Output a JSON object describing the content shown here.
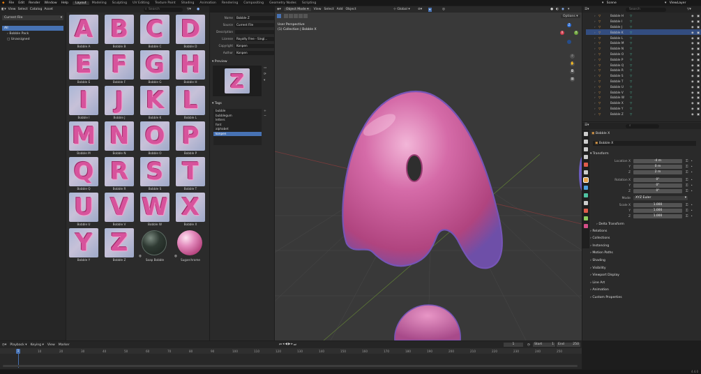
{
  "menubar": {
    "menus": [
      "File",
      "Edit",
      "Render",
      "Window",
      "Help"
    ],
    "workspaces": [
      "Layout",
      "Modeling",
      "Sculpting",
      "UV Editing",
      "Texture Paint",
      "Shading",
      "Animation",
      "Rendering",
      "Compositing",
      "Geometry Nodes",
      "Scripting"
    ],
    "active_workspace": "Layout",
    "scene": "Scene",
    "view_layer": "ViewLayer"
  },
  "asset_browser": {
    "header_menus": [
      "View",
      "Select",
      "Catalog",
      "Asset"
    ],
    "library": "Current File",
    "search_placeholder": "Search",
    "catalog_tree": [
      "All",
      "Bobble Pack",
      "Unassigned"
    ],
    "assets": [
      {
        "name": "Bobble A",
        "glyph": "A"
      },
      {
        "name": "Bobble B",
        "glyph": "B"
      },
      {
        "name": "Bobble C",
        "glyph": "C"
      },
      {
        "name": "Bobble D",
        "glyph": "D"
      },
      {
        "name": "Bobble E",
        "glyph": "E"
      },
      {
        "name": "Bobble F",
        "glyph": "F"
      },
      {
        "name": "Bobble G",
        "glyph": "G"
      },
      {
        "name": "Bobble H",
        "glyph": "H"
      },
      {
        "name": "Bobble I",
        "glyph": "I"
      },
      {
        "name": "Bobble J",
        "glyph": "J"
      },
      {
        "name": "Bobble K",
        "glyph": "K"
      },
      {
        "name": "Bobble L",
        "glyph": "L"
      },
      {
        "name": "Bobble M",
        "glyph": "M"
      },
      {
        "name": "Bobble N",
        "glyph": "N"
      },
      {
        "name": "Bobble O",
        "glyph": "O"
      },
      {
        "name": "Bobble P",
        "glyph": "P"
      },
      {
        "name": "Bobble Q",
        "glyph": "Q"
      },
      {
        "name": "Bobble R",
        "glyph": "R"
      },
      {
        "name": "Bobble S",
        "glyph": "S"
      },
      {
        "name": "Bobble T",
        "glyph": "T"
      },
      {
        "name": "Bobble U",
        "glyph": "U"
      },
      {
        "name": "Bobble V",
        "glyph": "V"
      },
      {
        "name": "Bobble W",
        "glyph": "W"
      },
      {
        "name": "Bobble X",
        "glyph": "X"
      },
      {
        "name": "Bobble Y",
        "glyph": "Y"
      },
      {
        "name": "Bobble Z",
        "glyph": "Z"
      },
      {
        "name": "Soap Bobble",
        "glyph": ""
      },
      {
        "name": "Sugarchrome",
        "glyph": ""
      }
    ]
  },
  "asset_details": {
    "fields": [
      {
        "label": "Name",
        "value": "Bobble Z"
      },
      {
        "label": "Source",
        "value": "Current File"
      },
      {
        "label": "Description",
        "value": ""
      },
      {
        "label": "License",
        "value": "Royalty Free - Singl..."
      },
      {
        "label": "Copyright",
        "value": "Konpen"
      },
      {
        "label": "Author",
        "value": "Konpen"
      }
    ],
    "preview_title": "Preview",
    "preview_glyph": "Z",
    "tags_title": "Tags",
    "tags": [
      "bubble",
      "bubblegum",
      "letters",
      "font",
      "alphabet",
      "konpen"
    ],
    "selected_tag": "konpen"
  },
  "viewport": {
    "header_menus": [
      "View",
      "Select",
      "Add",
      "Object"
    ],
    "mode": "Object Mode",
    "orientation": "Global",
    "options_label": "Options",
    "info_line1": "User Perspective",
    "info_line2": "(1) Collection | Bobble X",
    "axes": [
      "X",
      "Y",
      "Z"
    ]
  },
  "outliner": {
    "search_placeholder": "Search",
    "items": [
      "Bobble H",
      "Bobble I",
      "Bobble J",
      "Bobble K",
      "Bobble L",
      "Bobble M",
      "Bobble N",
      "Bobble O",
      "Bobble P",
      "Bobble Q",
      "Bobble R",
      "Bobble S",
      "Bobble T",
      "Bobble U",
      "Bobble V",
      "Bobble W",
      "Bobble X",
      "Bobble Y",
      "Bobble Z"
    ],
    "selected": "Bobble K"
  },
  "properties": {
    "object_name_header": "Bobble X",
    "object_name": "Bobble X",
    "transform_title": "Transform",
    "location": [
      {
        "label": "Location X",
        "value": "-4 m"
      },
      {
        "label": "Y",
        "value": "0 m"
      },
      {
        "label": "Z",
        "value": "2 m"
      }
    ],
    "rotation": [
      {
        "label": "Rotation X",
        "value": "0°"
      },
      {
        "label": "Y",
        "value": "0°"
      },
      {
        "label": "Z",
        "value": "0°"
      }
    ],
    "mode_label": "Mode",
    "mode_value": "XYZ Euler",
    "scale": [
      {
        "label": "Scale X",
        "value": "1.000"
      },
      {
        "label": "Y",
        "value": "1.000"
      },
      {
        "label": "Z",
        "value": "1.000"
      }
    ],
    "delta_transform": "Delta Transform",
    "sections": [
      "Relations",
      "Collections",
      "Instancing",
      "Motion Paths",
      "Shading",
      "Visibility",
      "Viewport Display",
      "Line Art",
      "Animation",
      "Custom Properties"
    ]
  },
  "timeline": {
    "menus": [
      "Playback",
      "Keying",
      "View",
      "Marker"
    ],
    "current_frame": "1",
    "start_label": "Start",
    "start": "1",
    "end_label": "End",
    "end": "250",
    "ticks": [
      "0",
      "10",
      "20",
      "30",
      "40",
      "50",
      "60",
      "70",
      "80",
      "90",
      "100",
      "110",
      "120",
      "130",
      "140",
      "150",
      "160",
      "170",
      "180",
      "190",
      "200",
      "210",
      "220",
      "230",
      "240",
      "250"
    ],
    "playhead": "1"
  },
  "status": {
    "version": "4.4.0"
  },
  "colors": {
    "accent": "#4772b3",
    "bubble_pink": "#d7539c",
    "selection": "#334d80",
    "ui_bg": "#2b2b2b"
  }
}
